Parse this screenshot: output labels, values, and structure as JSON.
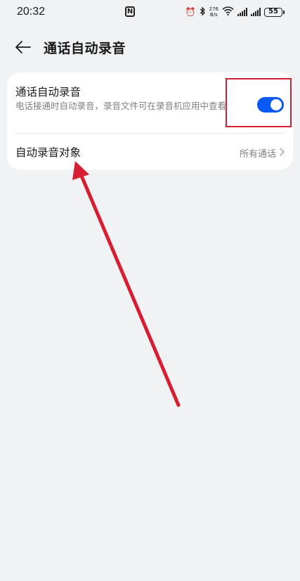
{
  "status_bar": {
    "time": "20:32",
    "nfc_label": "N",
    "net_speed_value": "276",
    "net_speed_unit": "B/s",
    "battery": "55"
  },
  "header": {
    "title": "通话自动录音"
  },
  "settings": {
    "auto_record": {
      "title": "通话自动录音",
      "description": "电话接通时自动录音，录音文件可在录音机应用中查看",
      "enabled": true
    },
    "record_target": {
      "label": "自动录音对象",
      "value": "所有通话"
    }
  },
  "colors": {
    "accent": "#0a59f7",
    "annotation": "#d71f33",
    "background": "#f1f2f4"
  }
}
